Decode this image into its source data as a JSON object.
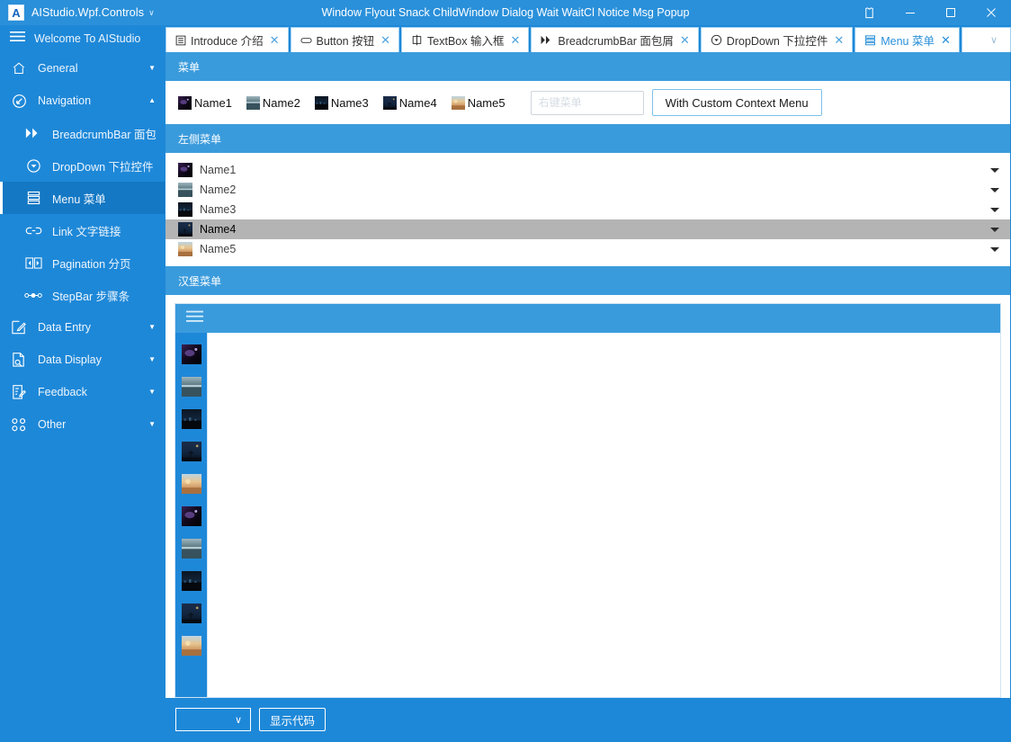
{
  "titlebar": {
    "logo_letter": "A",
    "app_title": "AIStudio.Wpf.Controls",
    "caret": "∨",
    "window_title": "Window Flyout Snack ChildWindow Dialog Wait WaitCl Notice Msg Popup",
    "theme_icon": "shirt-icon",
    "minimize_icon": "minimize-icon",
    "maximize_icon": "maximize-icon",
    "close_icon": "close-icon"
  },
  "sidebar": {
    "header": {
      "icon": "hamburger-icon",
      "label": "Welcome To AIStudio"
    },
    "items": [
      {
        "label": "General",
        "icon": "home-icon",
        "level": "group",
        "arrow": "▼",
        "selected": false
      },
      {
        "label": "Navigation",
        "icon": "navigation-icon",
        "level": "group",
        "arrow": "▲",
        "selected": false
      },
      {
        "label": "BreadcrumbBar 面包",
        "icon": "breadcrumb-icon",
        "level": "child",
        "arrow": "",
        "selected": false
      },
      {
        "label": "DropDown 下拉控件",
        "icon": "dropdown-icon",
        "level": "child",
        "arrow": "",
        "selected": false
      },
      {
        "label": "Menu 菜单",
        "icon": "menu-icon",
        "level": "child",
        "arrow": "",
        "selected": true
      },
      {
        "label": "Link 文字链接",
        "icon": "link-icon",
        "level": "child",
        "arrow": "",
        "selected": false
      },
      {
        "label": "Pagination 分页",
        "icon": "pagination-icon",
        "level": "child",
        "arrow": "",
        "selected": false
      },
      {
        "label": "StepBar 步骤条",
        "icon": "stepbar-icon",
        "level": "child",
        "arrow": "",
        "selected": false
      },
      {
        "label": "Data Entry",
        "icon": "data-entry-icon",
        "level": "group",
        "arrow": "▼",
        "selected": false
      },
      {
        "label": "Data Display",
        "icon": "data-display-icon",
        "level": "group",
        "arrow": "▼",
        "selected": false
      },
      {
        "label": "Feedback",
        "icon": "feedback-icon",
        "level": "group",
        "arrow": "▼",
        "selected": false
      },
      {
        "label": "Other",
        "icon": "other-icon",
        "level": "group",
        "arrow": "▼",
        "selected": false
      }
    ]
  },
  "tabs": {
    "items": [
      {
        "label": "Introduce 介绍",
        "icon": "document-icon",
        "close": "✕",
        "active": false
      },
      {
        "label": "Button 按钮",
        "icon": "button-icon",
        "close": "✕",
        "active": false
      },
      {
        "label": "TextBox 输入框",
        "icon": "textbox-icon",
        "close": "✕",
        "active": false
      },
      {
        "label": "BreadcrumbBar 面包屑",
        "icon": "breadcrumb-icon",
        "close": "✕",
        "active": false
      },
      {
        "label": "DropDown 下拉控件",
        "icon": "dropdown-icon",
        "close": "✕",
        "active": false
      },
      {
        "label": "Menu 菜单",
        "icon": "menu-icon",
        "close": "✕",
        "active": true
      }
    ],
    "overflow_icon": "∨"
  },
  "sections": {
    "menu": {
      "title": "菜单",
      "items": [
        {
          "label": "Name1",
          "thumb": "thumb-nebula"
        },
        {
          "label": "Name2",
          "thumb": "thumb-lake"
        },
        {
          "label": "Name3",
          "thumb": "thumb-city-night"
        },
        {
          "label": "Name4",
          "thumb": "thumb-tree-night"
        },
        {
          "label": "Name5",
          "thumb": "thumb-sunset"
        }
      ],
      "context_input": {
        "value": "",
        "placeholder": "右键菜单"
      },
      "context_button": "With Custom Context Menu"
    },
    "left_menu": {
      "title": "左侧菜单",
      "items": [
        {
          "label": "Name1",
          "thumb": "thumb-nebula",
          "selected": false,
          "caret": "chevron-down-icon"
        },
        {
          "label": "Name2",
          "thumb": "thumb-lake",
          "selected": false,
          "caret": "chevron-down-icon"
        },
        {
          "label": "Name3",
          "thumb": "thumb-city-night",
          "selected": false,
          "caret": "chevron-down-icon"
        },
        {
          "label": "Name4",
          "thumb": "thumb-tree-night",
          "selected": true,
          "caret": "chevron-down-icon"
        },
        {
          "label": "Name5",
          "thumb": "thumb-sunset",
          "selected": false,
          "caret": "chevron-down-icon"
        }
      ]
    },
    "hamburger": {
      "title": "汉堡菜单",
      "toggle_icon": "hamburger-icon",
      "rail_top": [
        {
          "thumb": "thumb-nebula"
        },
        {
          "thumb": "thumb-lake"
        },
        {
          "thumb": "thumb-city-night"
        },
        {
          "thumb": "thumb-tree-night"
        },
        {
          "thumb": "thumb-sunset"
        }
      ],
      "rail_bottom": [
        {
          "thumb": "thumb-nebula"
        },
        {
          "thumb": "thumb-lake"
        },
        {
          "thumb": "thumb-city-night"
        },
        {
          "thumb": "thumb-tree-night"
        },
        {
          "thumb": "thumb-sunset"
        }
      ]
    }
  },
  "footer": {
    "combo_value": "",
    "combo_caret": "∨",
    "show_code_button": "显示代码"
  },
  "colors": {
    "brand_blue": "#1e88d8",
    "header_blue": "#3a9bdc",
    "titlebar_blue": "#2a90da",
    "selection_gray": "#b4b4b4",
    "accent_white": "#ffffff"
  }
}
